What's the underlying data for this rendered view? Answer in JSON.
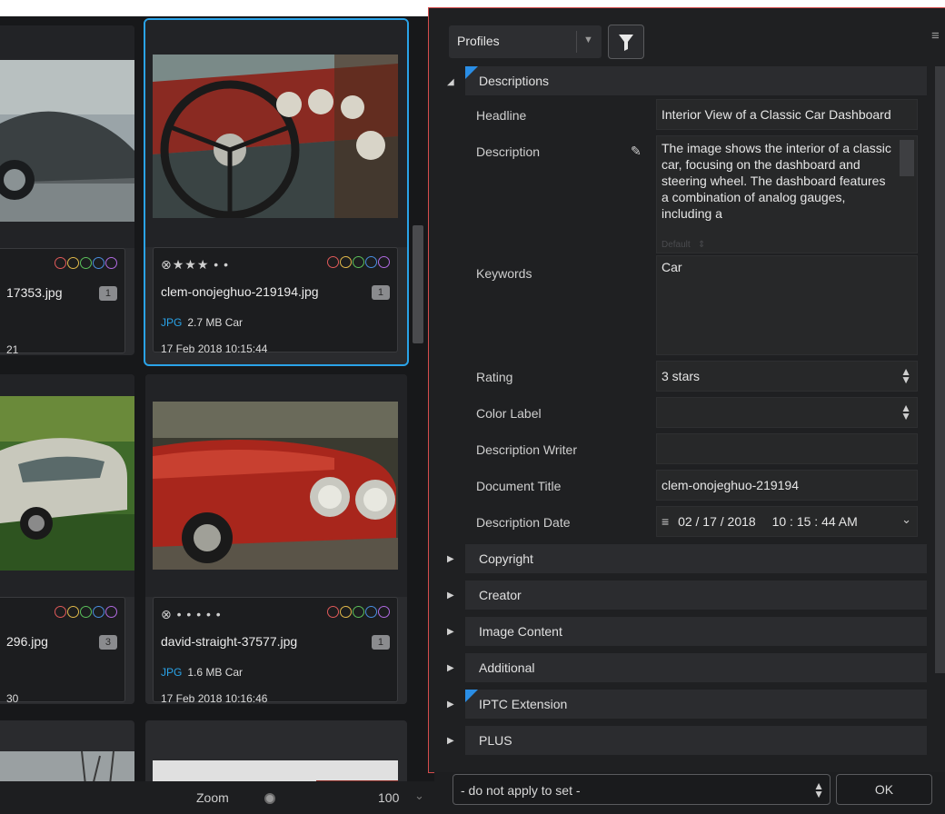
{
  "grid": {
    "cards": [
      {
        "filename": "17353.jpg",
        "badge": "1",
        "date": "21",
        "rating": "",
        "format": "",
        "meta": ""
      },
      {
        "filename": "clem-onojeghuo-219194.jpg",
        "badge": "1",
        "rating": "⊗★★★ • •",
        "format": "JPG",
        "meta": "2.7 MB  Car",
        "date": "17 Feb 2018 10:15:44"
      },
      {
        "filename": "296.jpg",
        "badge": "3",
        "date": "30",
        "rating": "",
        "format": "",
        "meta": ""
      },
      {
        "filename": "david-straight-37577.jpg",
        "badge": "1",
        "rating": "⊗ • • • • •",
        "format": "JPG",
        "meta": "1.6 MB  Car",
        "date": "17 Feb 2018 10:16:46"
      }
    ],
    "color_dots": [
      "#e05a5a",
      "#e0b84a",
      "#5abf5a",
      "#4a8ee0",
      "#b06ae0"
    ],
    "zoom_label": "Zoom",
    "zoom_value": "100"
  },
  "panel": {
    "profiles_label": "Profiles",
    "sections": {
      "descriptions": "Descriptions",
      "copyright": "Copyright",
      "creator": "Creator",
      "image_content": "Image Content",
      "additional": "Additional",
      "iptc_extension": "IPTC Extension",
      "plus": "PLUS"
    },
    "fields": {
      "headline_label": "Headline",
      "headline_value": "Interior View of a Classic Car Dashboard",
      "description_label": "Description",
      "description_value": "The image shows the interior of a classic car, focusing on the dashboard and steering wheel. The dashboard features a combination of analog gauges, including a",
      "description_default": "Default",
      "keywords_label": "Keywords",
      "keywords_value": "Car",
      "rating_label": "Rating",
      "rating_value": "3 stars",
      "color_label_label": "Color Label",
      "color_label_value": "",
      "writer_label": "Description Writer",
      "writer_value": "",
      "doc_title_label": "Document Title",
      "doc_title_value": "clem-onojeghuo-219194",
      "date_label": "Description Date",
      "date_value": "02 / 17 / 2018",
      "time_value": "10 : 15 : 44 AM"
    },
    "apply_select": "- do not apply to set -",
    "ok_label": "OK"
  }
}
